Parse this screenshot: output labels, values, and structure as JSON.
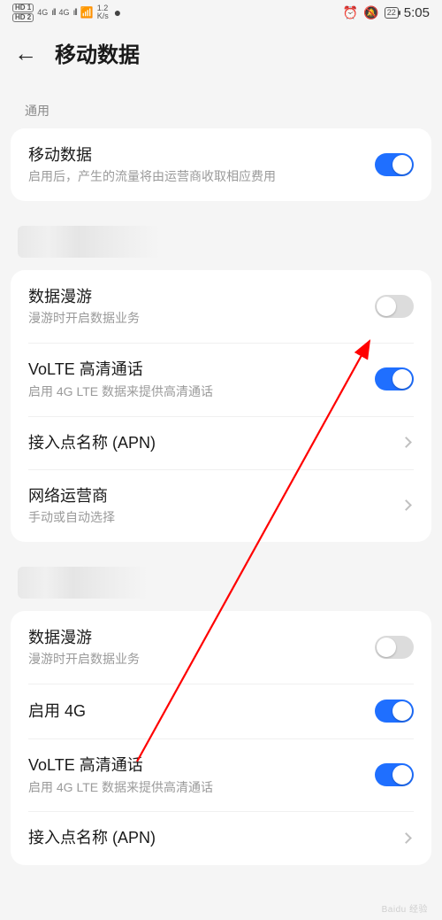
{
  "colors": {
    "accent": "#1f6fff",
    "toggle_off": "#dcdcdc",
    "text_secondary": "#9a9a9a"
  },
  "status": {
    "hd1": "HD 1",
    "hd2": "HD 2",
    "net1": "4G",
    "net2": "4G",
    "speed_val": "1.2",
    "speed_unit": "K/s",
    "battery": "22",
    "time": "5:05"
  },
  "header": {
    "title": "移动数据"
  },
  "section1": {
    "label": "通用",
    "mobile_data": {
      "title": "移动数据",
      "sub": "启用后，产生的流量将由运营商收取相应费用",
      "on": true
    }
  },
  "section2": {
    "roaming": {
      "title": "数据漫游",
      "sub": "漫游时开启数据业务",
      "on": false
    },
    "volte": {
      "title": "VoLTE 高清通话",
      "sub": "启用 4G LTE 数据来提供高清通话",
      "on": true
    },
    "apn": {
      "title": "接入点名称 (APN)"
    },
    "carrier": {
      "title": "网络运营商",
      "sub": "手动或自动选择"
    }
  },
  "section3": {
    "roaming": {
      "title": "数据漫游",
      "sub": "漫游时开启数据业务",
      "on": false
    },
    "enable4g": {
      "title": "启用 4G",
      "on": true
    },
    "volte": {
      "title": "VoLTE 高清通话",
      "sub": "启用 4G LTE 数据来提供高清通话",
      "on": true
    },
    "apn": {
      "title": "接入点名称 (APN)"
    }
  }
}
